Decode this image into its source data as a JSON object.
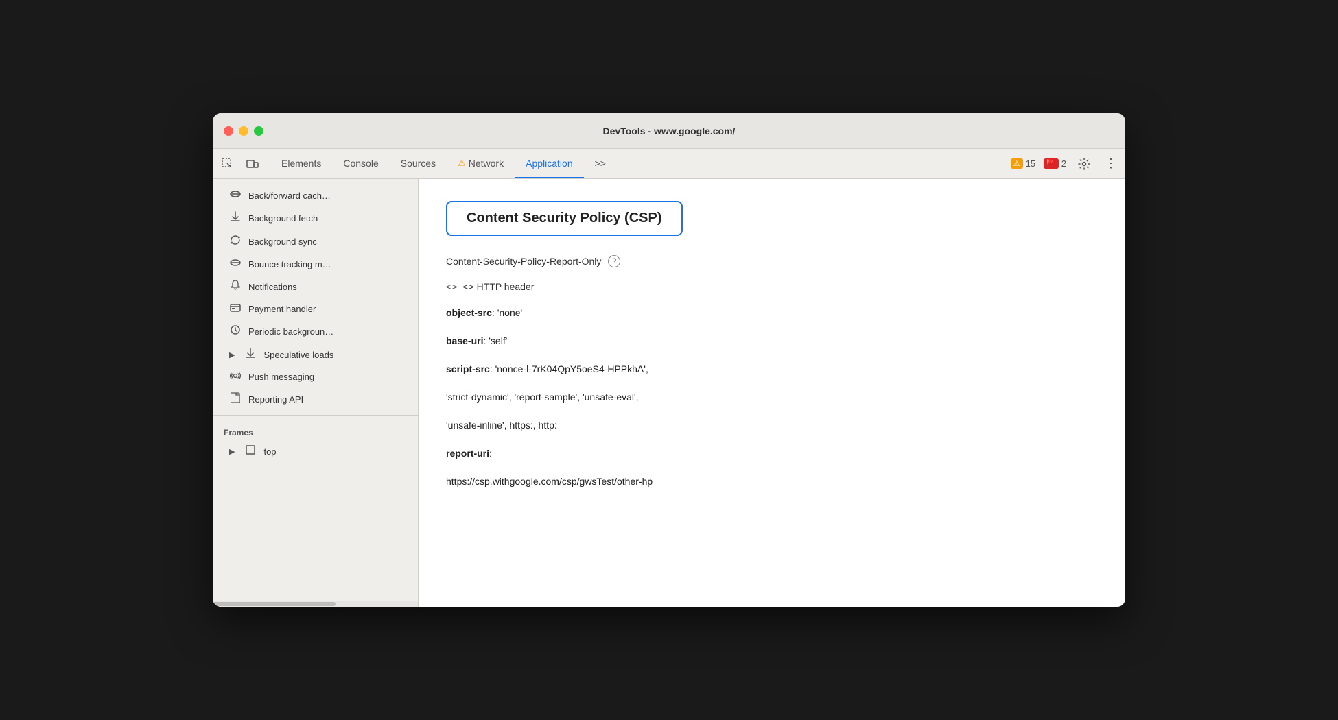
{
  "window": {
    "title": "DevTools - www.google.com/"
  },
  "toolbar": {
    "tabs": [
      {
        "id": "elements",
        "label": "Elements",
        "active": false,
        "warning": false
      },
      {
        "id": "console",
        "label": "Console",
        "active": false,
        "warning": false
      },
      {
        "id": "sources",
        "label": "Sources",
        "active": false,
        "warning": false
      },
      {
        "id": "network",
        "label": "Network",
        "active": false,
        "warning": true
      },
      {
        "id": "application",
        "label": "Application",
        "active": true,
        "warning": false
      }
    ],
    "more_tabs": ">>",
    "warning_count": "15",
    "error_count": "2"
  },
  "sidebar": {
    "items": [
      {
        "id": "back-forward",
        "icon": "db",
        "label": "Back/forward cach…",
        "indent": false
      },
      {
        "id": "bg-fetch",
        "icon": "↕",
        "label": "Background fetch",
        "indent": false
      },
      {
        "id": "bg-sync",
        "icon": "↻",
        "label": "Background sync",
        "indent": false
      },
      {
        "id": "bounce-tracking",
        "icon": "db",
        "label": "Bounce tracking m…",
        "indent": false
      },
      {
        "id": "notifications",
        "icon": "🔔",
        "label": "Notifications",
        "indent": false
      },
      {
        "id": "payment-handler",
        "icon": "💳",
        "label": "Payment handler",
        "indent": false
      },
      {
        "id": "periodic-bg",
        "icon": "⊙",
        "label": "Periodic backgroun…",
        "indent": false
      },
      {
        "id": "speculative-loads",
        "icon": "↕",
        "label": "Speculative loads",
        "indent": false,
        "arrow": true
      },
      {
        "id": "push-messaging",
        "icon": "☁",
        "label": "Push messaging",
        "indent": false
      },
      {
        "id": "reporting-api",
        "icon": "📄",
        "label": "Reporting API",
        "indent": false
      }
    ],
    "frames_section": "Frames",
    "frames_item": "top"
  },
  "content": {
    "csp_title": "Content Security Policy (CSP)",
    "policy_name": "Content-Security-Policy-Report-Only",
    "http_header_label": "<> HTTP header",
    "values": [
      {
        "key": "object-src",
        "value": ": 'none'"
      },
      {
        "key": "base-uri",
        "value": ": 'self'"
      },
      {
        "key": "script-src",
        "value": ": 'nonce-l-7rK04QpY5oeS4-HPPkhA',"
      },
      {
        "key": "",
        "value": "'strict-dynamic', 'report-sample', 'unsafe-eval',"
      },
      {
        "key": "",
        "value": "'unsafe-inline', https:, http:"
      },
      {
        "key": "report-uri",
        "value": ":"
      },
      {
        "key": "",
        "value": "https://csp.withgoogle.com/csp/gwsTest/other-hp"
      }
    ]
  }
}
